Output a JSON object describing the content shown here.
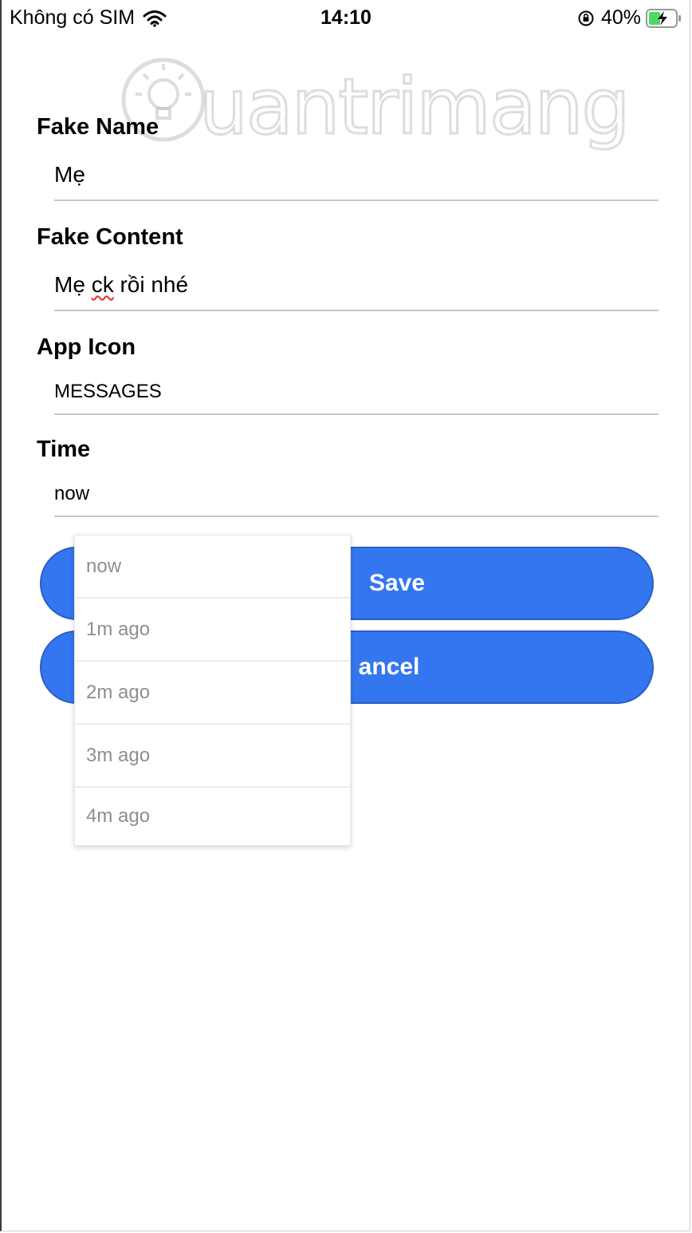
{
  "status_bar": {
    "carrier": "Không có SIM",
    "time": "14:10",
    "battery": "40%"
  },
  "watermark": {
    "text": "uantrimang",
    "icon": "lightbulb-icon"
  },
  "form": {
    "fake_name": {
      "label": "Fake Name",
      "value": "Mẹ"
    },
    "fake_content": {
      "label": "Fake Content",
      "value_word1": "Mẹ ",
      "value_misspelled": "ck",
      "value_rest": " rồi nhé"
    },
    "app_icon": {
      "label": "App Icon",
      "value": "MESSAGES"
    },
    "time": {
      "label": "Time",
      "value": "now"
    }
  },
  "buttons": {
    "save_visible": "Save",
    "cancel_visible": "ancel"
  },
  "time_dropdown": {
    "options": [
      "now",
      "1m ago",
      "2m ago",
      "3m ago",
      "4m ago"
    ]
  },
  "colors": {
    "accent": "#3376f0",
    "divider": "#c8c8c8",
    "option_text": "#8e8e8e"
  }
}
